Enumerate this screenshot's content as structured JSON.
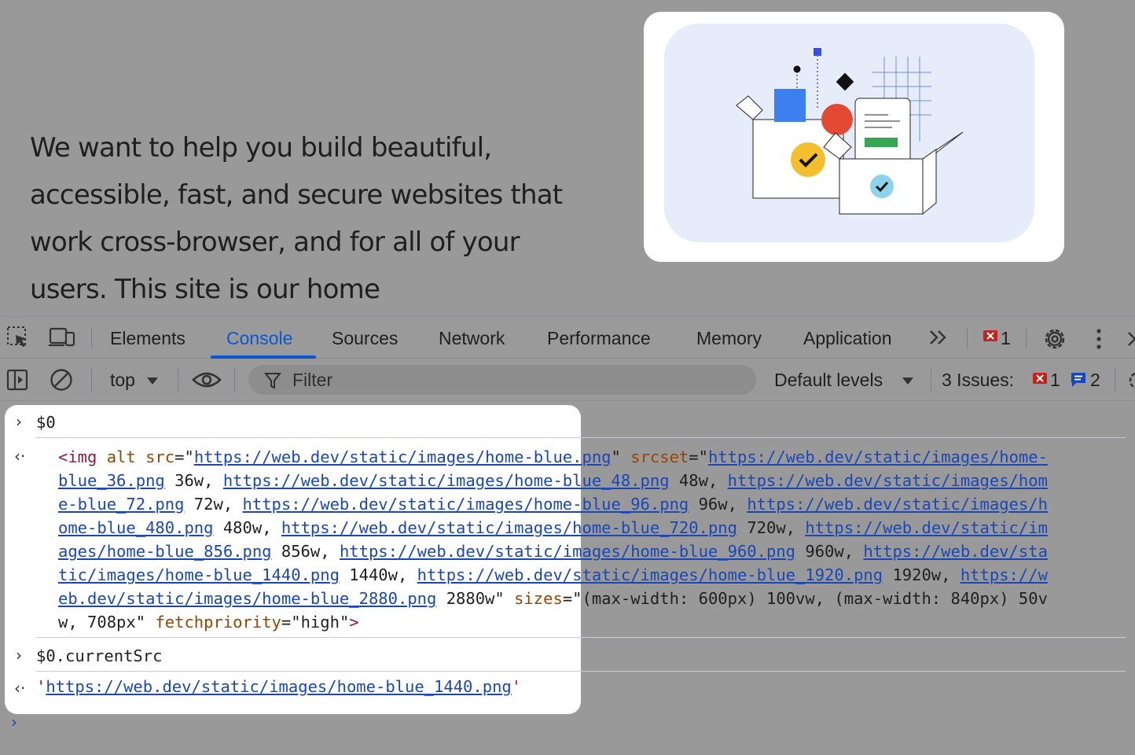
{
  "page": {
    "paragraph": "We want to help you build beautiful, accessible, fast, and secure websites that work cross-browser, and for all of your users. This site is our home"
  },
  "devtools": {
    "tabs": [
      "Elements",
      "Console",
      "Sources",
      "Network",
      "Performance",
      "Memory",
      "Application"
    ],
    "active_tab": "Console",
    "error_count": "1",
    "toolbar": {
      "context": "top",
      "filter_placeholder": "Filter",
      "levels": "Default levels",
      "issues_label": "3 Issues:",
      "issues_errors": "1",
      "issues_info": "2"
    },
    "console": {
      "input1": "$0",
      "output1": {
        "tag_open": "<img",
        "attr_alt": "alt",
        "attr_src": "src",
        "src_url": "https://web.dev/static/images/home-blue.png",
        "attr_srcset": "srcset",
        "srcset_lines": [
          "https://web.dev/static/images/home-",
          "blue_36.png",
          "36w,",
          "https://web.dev/static/images/home-blue_48.png",
          "48w,",
          "https://web.dev/static/images/hom",
          "e-blue_72.png",
          "72w,",
          "https://web.dev/static/images/home-blue_96.png",
          "96w,",
          "https://web.dev/static/images/h",
          "ome-blue_480.png",
          "480w,",
          "https://web.dev/static/images/home-blue_720.png",
          "720w,",
          "https://web.dev/static/im",
          "ages/home-blue_856.png",
          "856w,",
          "https://web.dev/static/images/home-blue_960.png",
          "960w,",
          "https://web.dev/sta",
          "tic/images/home-blue_1440.png",
          "1440w,",
          "https://web.dev/static/images/home-blue_1920.png",
          "1920w,",
          "https://w",
          "eb.dev/static/images/home-blue_2880.png",
          "2880w"
        ],
        "attr_sizes": "sizes",
        "sizes_a": "(max-width: 600px) 100vw, (max-width: 840px) 50v",
        "sizes_b": "w, 708px",
        "attr_fetchpriority": "fetchpriority",
        "fetchpriority_value": "high",
        "tag_close": ">"
      },
      "input2": "$0.currentSrc",
      "output2": "https://web.dev/static/images/home-blue_1440.png"
    }
  }
}
